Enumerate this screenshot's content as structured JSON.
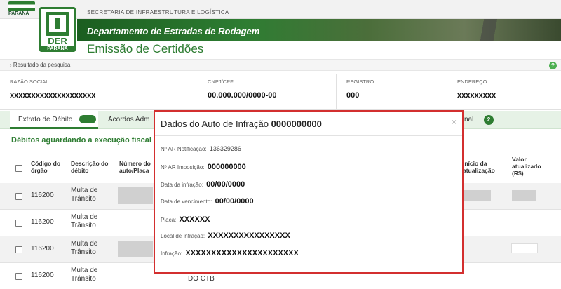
{
  "header": {
    "gov_text": "PARANÁ",
    "secretaria": "SECRETARIA DE INFRAESTRUTURA E LOGÍSTICA",
    "department": "Departamento de Estradas de Rodagem",
    "logo_text": "DER",
    "logo_subtext": "PARANÁ",
    "page_title": "Emissão de Certidões"
  },
  "breadcrumb": "› Resultado da pesquisa",
  "help_icon": "?",
  "info": {
    "razao_social": {
      "label": "RAZÃO SOCIAL",
      "value": "xxxxxxxxxxxxxxxxxxxx"
    },
    "cnpj": {
      "label": "CNPJ/CPF",
      "value": "00.000.000/0000-00"
    },
    "registro": {
      "label": "REGISTRO",
      "value": "000"
    },
    "endereco": {
      "label": "ENDEREÇO",
      "value": "xxxxxxxxx"
    }
  },
  "tabs": [
    {
      "label": "Extrato de Débito"
    },
    {
      "label": "Acordos Adm"
    },
    {
      "label": "nal",
      "badge": "2"
    }
  ],
  "section_title": "Débitos aguardando a execução fiscal",
  "table": {
    "headers": {
      "codigo": "Código do órgão",
      "descricao": "Descrição do débito",
      "numero": "Número do auto/Placa",
      "inicio": "Início da atualização",
      "valor": "Valor atualizado (R$)"
    },
    "rows": [
      {
        "codigo": "116200",
        "descricao": "Multa de Trânsito"
      },
      {
        "codigo": "116200",
        "descricao": "Multa de Trânsito"
      },
      {
        "codigo": "116200",
        "descricao": "Multa de Trânsito"
      },
      {
        "codigo": "116200",
        "descricao": "Multa de Trânsito"
      }
    ],
    "bottom_text": "DO CTB"
  },
  "modal": {
    "title": "Dados do Auto de Infração",
    "title_code": "0000000000",
    "close": "×",
    "fields": [
      {
        "label": "Nº AR Notificação:",
        "value": "136329286"
      },
      {
        "label": "Nº AR Imposição:",
        "value": "000000000"
      },
      {
        "label": "Data da infração:",
        "value": "00/00/0000"
      },
      {
        "label": "Data de vencimento:",
        "value": "00/00/0000"
      },
      {
        "label": "Placa:",
        "value": "XXXXXX"
      },
      {
        "label": "Local de infração:",
        "value": "XXXXXXXXXXXXXXXX"
      },
      {
        "label": "Infração:",
        "value": "XXXXXXXXXXXXXXXXXXXXXX"
      }
    ]
  },
  "colors": {
    "brand_green": "#2e7d32",
    "modal_border": "#d32f2f"
  }
}
